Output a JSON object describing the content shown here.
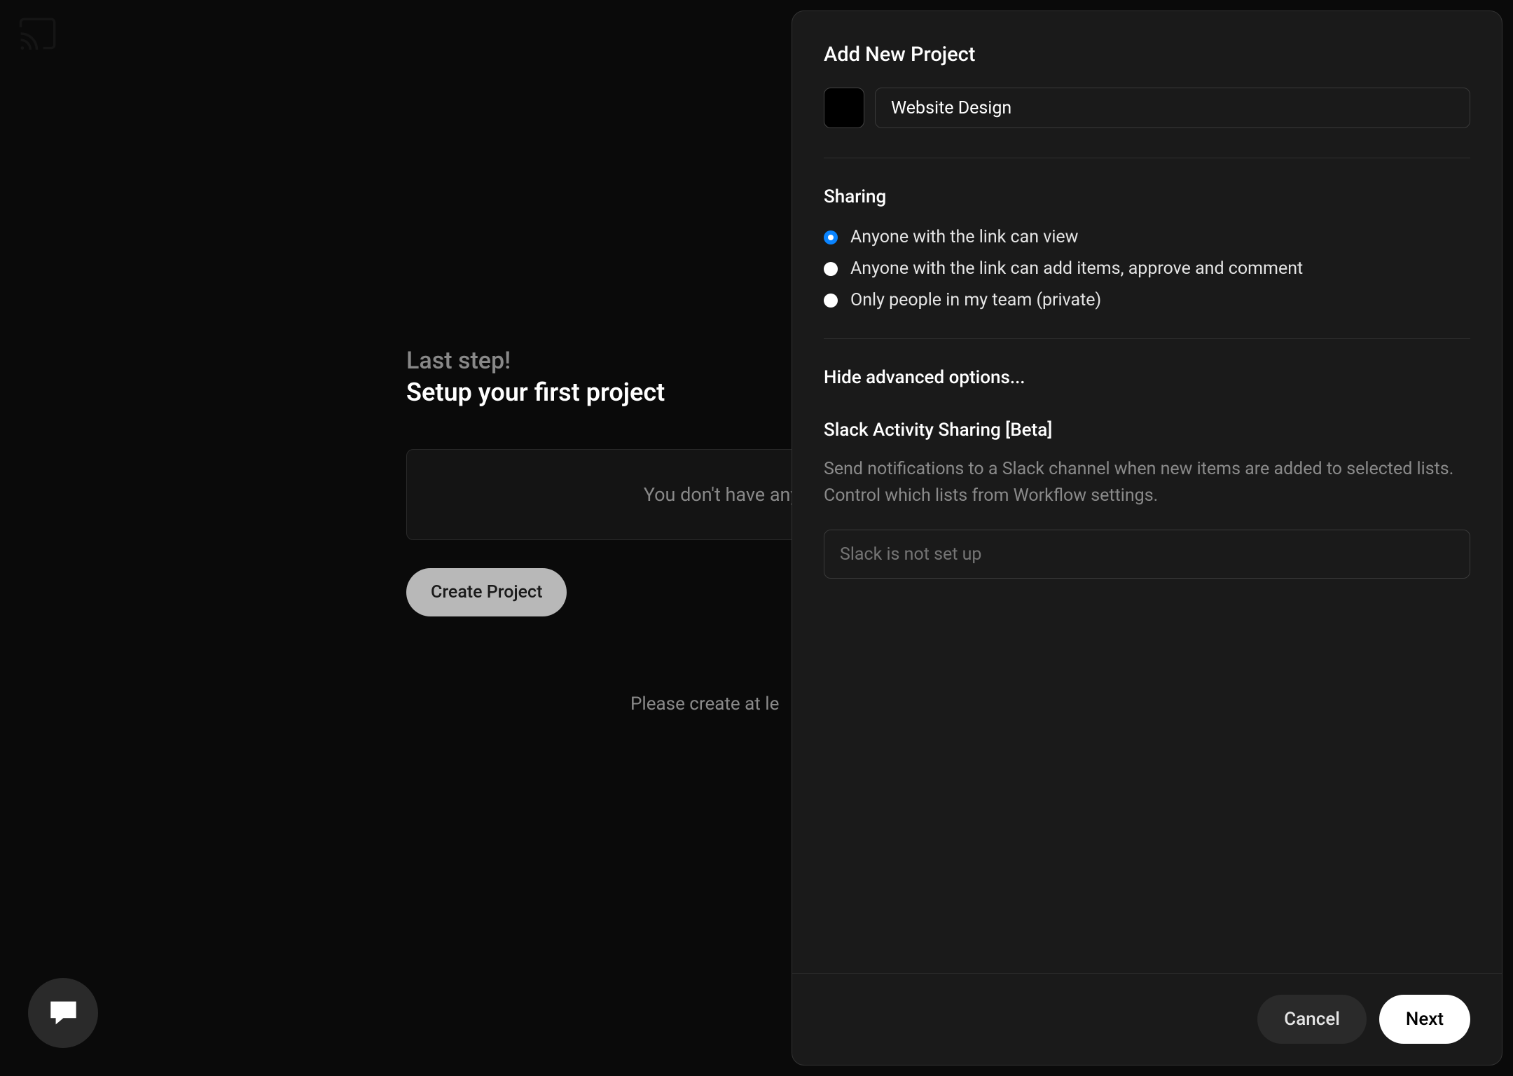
{
  "main": {
    "last_step": "Last step!",
    "setup_title": "Setup your first project",
    "empty_text": "You don't have any",
    "create_button": "Create Project",
    "helper": "Please create at le"
  },
  "modal": {
    "title": "Add New Project",
    "project_name": "Website Design",
    "sharing": {
      "title": "Sharing",
      "options": [
        "Anyone with the link can view",
        "Anyone with the link can add items, approve and comment",
        "Only people in my team (private)"
      ],
      "selected_index": 0
    },
    "advanced_toggle": "Hide advanced options...",
    "slack": {
      "title": "Slack Activity Sharing [Beta]",
      "description": "Send notifications to a Slack channel when new items are added to selected lists. Control which lists from Workflow settings.",
      "placeholder": "Slack is not set up"
    },
    "footer": {
      "cancel": "Cancel",
      "next": "Next"
    }
  }
}
